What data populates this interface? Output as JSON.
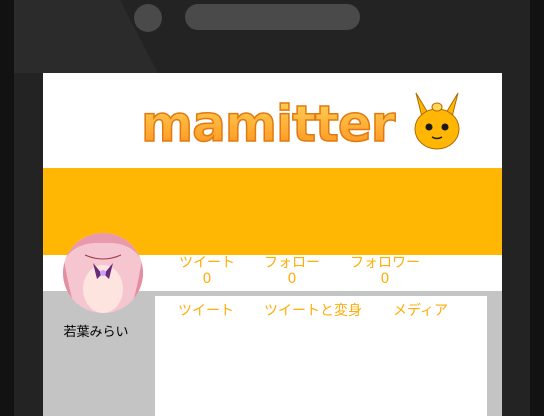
{
  "app": {
    "logo_text": "mamitter",
    "mascot": "kyubey-mascot-icon"
  },
  "colors": {
    "accent": "#ffb703",
    "label": "#ffad0a",
    "device": "#232323",
    "lower_bg": "#c4c4c4"
  },
  "profile": {
    "name": "若葉みらい",
    "avatar": "avatar-image"
  },
  "stats": [
    {
      "label": "ツイート",
      "value": "0"
    },
    {
      "label": "フォロー",
      "value": "0"
    },
    {
      "label": "フォロワー",
      "value": "0"
    }
  ],
  "tabs": [
    {
      "label": "ツイート"
    },
    {
      "label": "ツイートと変身"
    },
    {
      "label": "メディア"
    }
  ]
}
